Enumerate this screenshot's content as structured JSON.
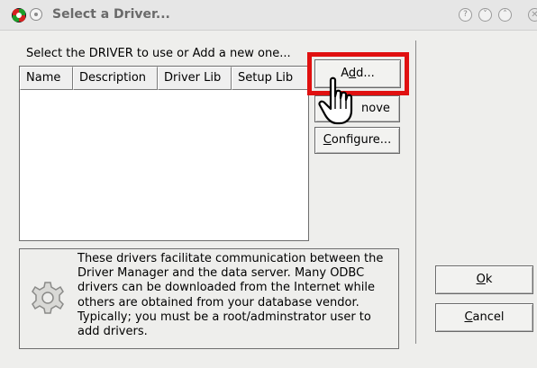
{
  "window": {
    "title": "Select a Driver...",
    "app_icon": "odbc-app-icon",
    "title_buttons": [
      "help-icon",
      "minimize-icon",
      "maximize-icon",
      "close-icon"
    ]
  },
  "prompt": "Select the DRIVER to use or Add a new one...",
  "list": {
    "columns": [
      "Name",
      "Description",
      "Driver Lib",
      "Setup Lib"
    ],
    "rows": []
  },
  "buttons": {
    "add": {
      "before": "A",
      "mnemonic": "d",
      "after": "d..."
    },
    "remove": {
      "visible": "nove"
    },
    "configure": {
      "mnemonic": "C",
      "after": "onfigure..."
    },
    "ok": {
      "mnemonic": "O",
      "after": "k"
    },
    "cancel": {
      "mnemonic": "C",
      "after": "ancel"
    }
  },
  "info": {
    "icon": "gear-icon",
    "lines": [
      "These drivers facilitate communication between the",
      "Driver Manager and the data server. Many ODBC",
      "drivers can be downloaded from the Internet while",
      "others are obtained from your database vendor.",
      "Typically; you must be a root/adminstrator user to",
      "add drivers."
    ]
  },
  "colors": {
    "highlight": "#e01010",
    "window_bg": "#eeeeec"
  }
}
